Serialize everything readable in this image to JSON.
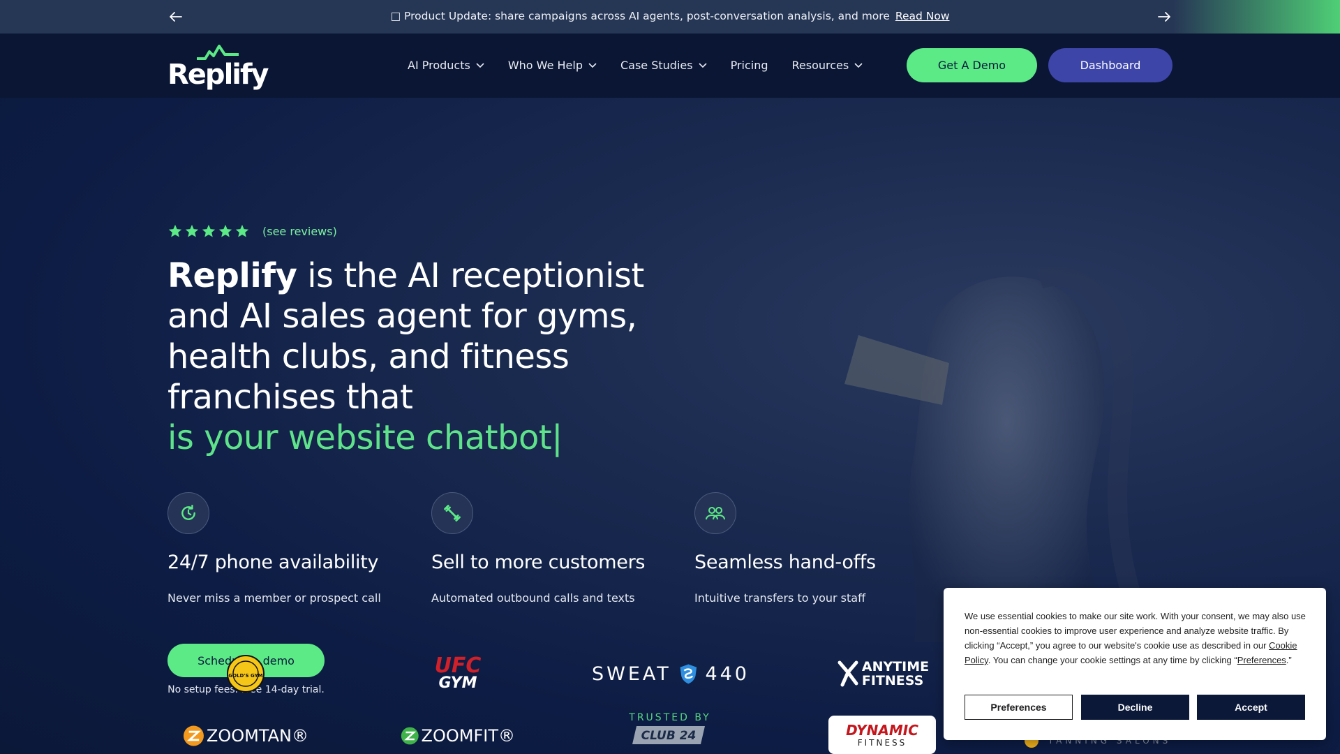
{
  "announcement": {
    "message": "□ Product Update: share campaigns across AI agents, post-conversation analysis, and more",
    "link_label": "Read Now"
  },
  "brand": {
    "name": "Replify",
    "accent": "#5cea86",
    "navy": "#0b1a3d",
    "indigo": "#3d45a8"
  },
  "nav": {
    "items": [
      {
        "label": "AI Products",
        "has_dropdown": true
      },
      {
        "label": "Who We Help",
        "has_dropdown": true
      },
      {
        "label": "Case Studies",
        "has_dropdown": true
      },
      {
        "label": "Pricing",
        "has_dropdown": false
      },
      {
        "label": "Resources",
        "has_dropdown": true
      }
    ],
    "cta_demo": "Get A Demo",
    "cta_dashboard": "Dashboard"
  },
  "hero": {
    "rating_stars": 5,
    "reviews_link": "(see reviews)",
    "headline_brand": "Replify",
    "headline_rest": " is the AI receptionist and AI sales agent for gyms, health clubs, and fitness franchises that",
    "headline_rotating": "is your website chatbot|",
    "features": [
      {
        "icon": "clock-refresh-icon",
        "title": "24/7 phone availability",
        "desc": "Never miss a member or prospect call"
      },
      {
        "icon": "dumbbell-icon",
        "title": "Sell to more customers",
        "desc": "Automated outbound calls and texts"
      },
      {
        "icon": "people-icon",
        "title": "Seamless hand-offs",
        "desc": "Intuitive transfers to your staff"
      }
    ],
    "schedule_button": "Schedule a demo",
    "no_setup": "No setup fees. Free 14-day trial."
  },
  "trusted": {
    "label": "TRUSTED BY",
    "logos": {
      "gold": "GOLD'S GYM",
      "ufc_top": "UFC",
      "ufc_bottom": "GYM",
      "sweat_a": "SWEAT",
      "sweat_b": "440",
      "anytime_a": "ANYTIME",
      "anytime_b": "FITNESS",
      "zoomtan": "ZOOMTAN®",
      "zoomfit": "ZOOMFIT®",
      "club24": "CLUB 24",
      "dynamic_a": "DYNAMIC",
      "dynamic_b": "FITNESS",
      "tanning": "TANNING SALONS"
    }
  },
  "cookie": {
    "text_part1": "We use essential cookies to make our site work. With your consent, we may also use non-essential cookies to improve user experience and analyze website traffic. By clicking “Accept,” you agree to our website's cookie use as described in our ",
    "cookie_policy_link": "Cookie Policy",
    "text_part2": ". You can change your cookie settings at any time by clicking “",
    "preferences_link": "Preferences",
    "text_part3": ".”",
    "preferences_button": "Preferences",
    "decline_button": "Decline",
    "accept_button": "Accept"
  }
}
